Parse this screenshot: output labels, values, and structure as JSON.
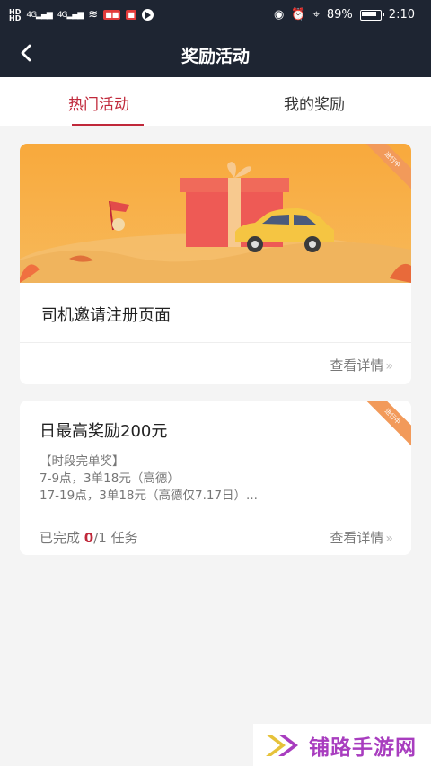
{
  "status_bar": {
    "network_1": "4G",
    "network_2": "4G",
    "battery": "89%",
    "time": "2:10"
  },
  "header": {
    "title": "奖励活动",
    "back_icon": "back-arrow-icon"
  },
  "tabs": [
    {
      "label": "热门活动",
      "active": true
    },
    {
      "label": "我的奖励",
      "active": false
    }
  ],
  "cards": [
    {
      "title": "司机邀请注册页面",
      "detail_label": "查看详情"
    },
    {
      "title": "日最高奖励200元",
      "lines": [
        "【时段完单奖】",
        "7-9点，3单18元（高德）",
        "17-19点，3单18元（高德仅7.17日）..."
      ],
      "progress_prefix": "已完成 ",
      "progress_done": "0",
      "progress_rest": "/1 任务",
      "detail_label": "查看详情"
    }
  ],
  "watermark": {
    "text": "铺路手游网"
  },
  "colors": {
    "accent": "#c0283a",
    "nav_bg": "#1e2532",
    "banner_orange": "#f6a03a",
    "ribbon": "#f29a5a",
    "watermark": "#a83dbf"
  }
}
